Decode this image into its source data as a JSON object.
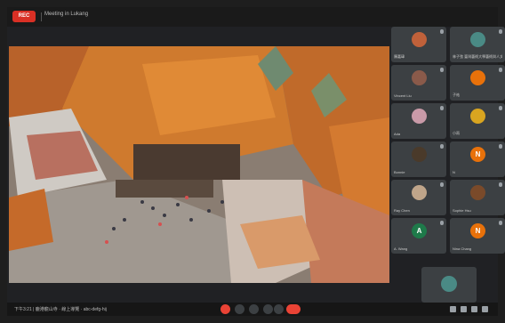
{
  "topbar": {
    "rec_label": "REC",
    "meeting_title": "Meeting in Lukang"
  },
  "participants": [
    {
      "name": "陳嘉瑋",
      "avatar": "photo",
      "color": "#c0613a"
    },
    {
      "name": "林子弦 臺灣藝術大學藝術與人文教育研究所",
      "avatar": "photo",
      "color": "#4a8a85"
    },
    {
      "name": "Vincent Liu",
      "avatar": "photo",
      "color": "#8a5a4a"
    },
    {
      "name": "子祐",
      "avatar": "photo",
      "color": "#e8710a"
    },
    {
      "name": "Ada",
      "avatar": "photo",
      "color": "#c99aa8"
    },
    {
      "name": "小雨",
      "avatar": "photo",
      "color": "#d9a520"
    },
    {
      "name": "Bonnie",
      "avatar": "photo",
      "color": "#4a3a2a"
    },
    {
      "name": "N",
      "avatar": "letter",
      "letter": "N",
      "color": "#e8710a"
    },
    {
      "name": "Ray Chen",
      "avatar": "photo",
      "color": "#bfa58a"
    },
    {
      "name": "Sophie Hsu",
      "avatar": "photo",
      "color": "#7a4a2a"
    },
    {
      "name": "A. Wang",
      "avatar": "letter",
      "letter": "A",
      "color": "#1e7a4a"
    },
    {
      "name": "Nina Chang",
      "avatar": "letter",
      "letter": "N",
      "color": "#e8710a"
    }
  ],
  "bottombar": {
    "meeting_info": "下午3:21 | 鹿港龍山寺 · 線上導覽 · abc-defg-hij"
  },
  "colors": {
    "accent_red": "#ea4335",
    "tile_bg": "#3c4043"
  }
}
